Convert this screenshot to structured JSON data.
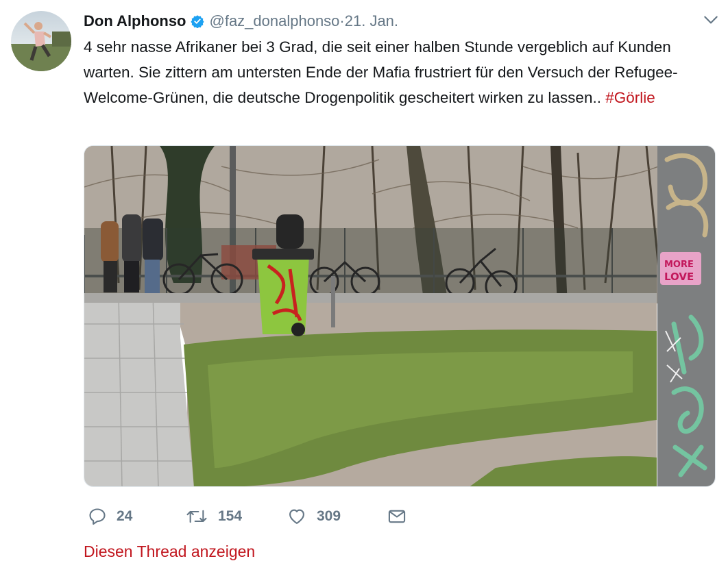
{
  "tweet": {
    "author_name": "Don Alphonso",
    "handle": "@faz_donalphonso",
    "separator": " · ",
    "date": "21. Jan.",
    "text": "4 sehr nasse Afrikaner bei 3 Grad, die seit einer halben Stunde vergeblich auf Kunden warten. Sie zittern am untersten Ende der Mafia frustriert für den Versuch der Refugee-Welcome-Grünen, die deutsche Drogenpolitik gescheitert wirken zu lassen.. ",
    "hashtag": "#Görlie"
  },
  "icons": {
    "verified": "verified-badge-icon",
    "menu": "chevron-down-icon",
    "reply": "reply-icon",
    "retweet": "retweet-icon",
    "like": "heart-icon",
    "dm": "envelope-icon"
  },
  "actions": {
    "reply_count": "24",
    "retweet_count": "154",
    "like_count": "309"
  },
  "thread_link": "Diesen Thread anzeigen",
  "colors": {
    "accent": "#c1161e",
    "muted": "#657786",
    "verified": "#1da1f2"
  }
}
